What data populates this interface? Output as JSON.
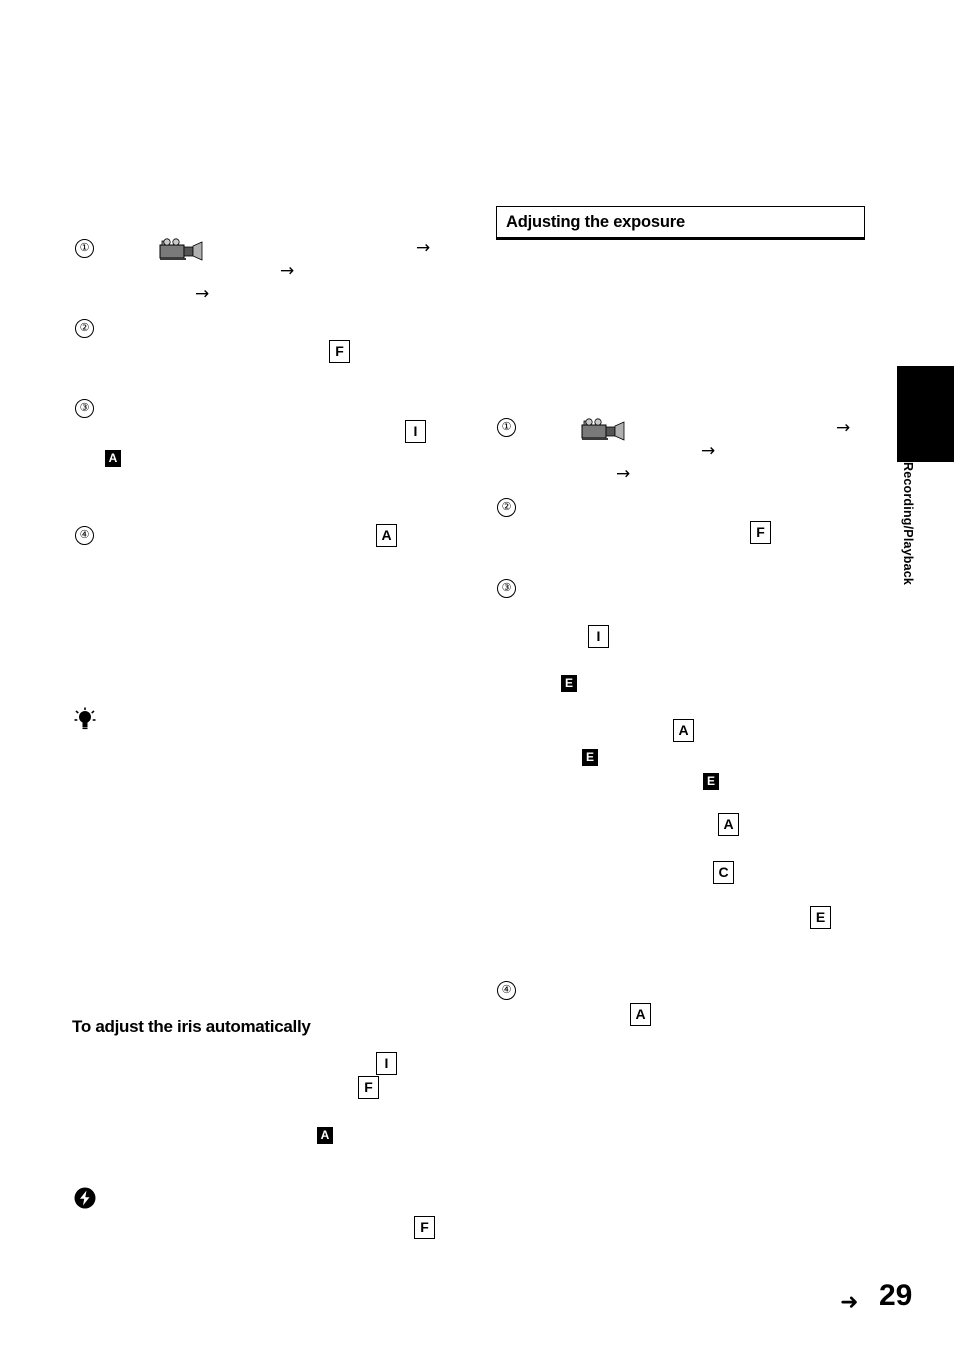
{
  "page": {
    "number": "29",
    "arrow_glyph": "➜"
  },
  "side_tab": {
    "label": "Recording/Playback"
  },
  "left_column": {
    "steps": [
      {
        "num": "①"
      },
      {
        "num": "②"
      },
      {
        "num": "③"
      },
      {
        "num": "④"
      }
    ],
    "callouts": [
      {
        "letter": "F",
        "style": "outline"
      },
      {
        "letter": "I",
        "style": "outline"
      },
      {
        "letter": "A",
        "style": "filled"
      },
      {
        "letter": "A",
        "style": "outline"
      }
    ],
    "subheading": "To adjust the iris automatically",
    "sub_callouts": [
      {
        "letter": "I",
        "style": "outline"
      },
      {
        "letter": "F",
        "style": "outline"
      },
      {
        "letter": "A",
        "style": "filled"
      },
      {
        "letter": "F",
        "style": "outline"
      }
    ],
    "arrows": [
      "→",
      "→",
      "→"
    ],
    "tip_icon": "tip-bulb-icon",
    "note_icon": "note-flash-icon",
    "camcorder_icon": "camcorder-icon"
  },
  "right_column": {
    "section_title": "Adjusting the exposure",
    "steps": [
      {
        "num": "①"
      },
      {
        "num": "②"
      },
      {
        "num": "③"
      },
      {
        "num": "④"
      }
    ],
    "arrows": [
      "→",
      "→",
      "→"
    ],
    "callouts": [
      {
        "letter": "F",
        "style": "outline"
      },
      {
        "letter": "I",
        "style": "outline"
      },
      {
        "letter": "E",
        "style": "filled"
      },
      {
        "letter": "A",
        "style": "outline"
      },
      {
        "letter": "E",
        "style": "filled"
      },
      {
        "letter": "E",
        "style": "filled"
      },
      {
        "letter": "A",
        "style": "outline"
      },
      {
        "letter": "C",
        "style": "outline"
      },
      {
        "letter": "E",
        "style": "outline"
      },
      {
        "letter": "A",
        "style": "outline"
      }
    ],
    "camcorder_icon": "camcorder-icon"
  },
  "colors": {
    "ink": "#000000",
    "paper": "#ffffff"
  }
}
